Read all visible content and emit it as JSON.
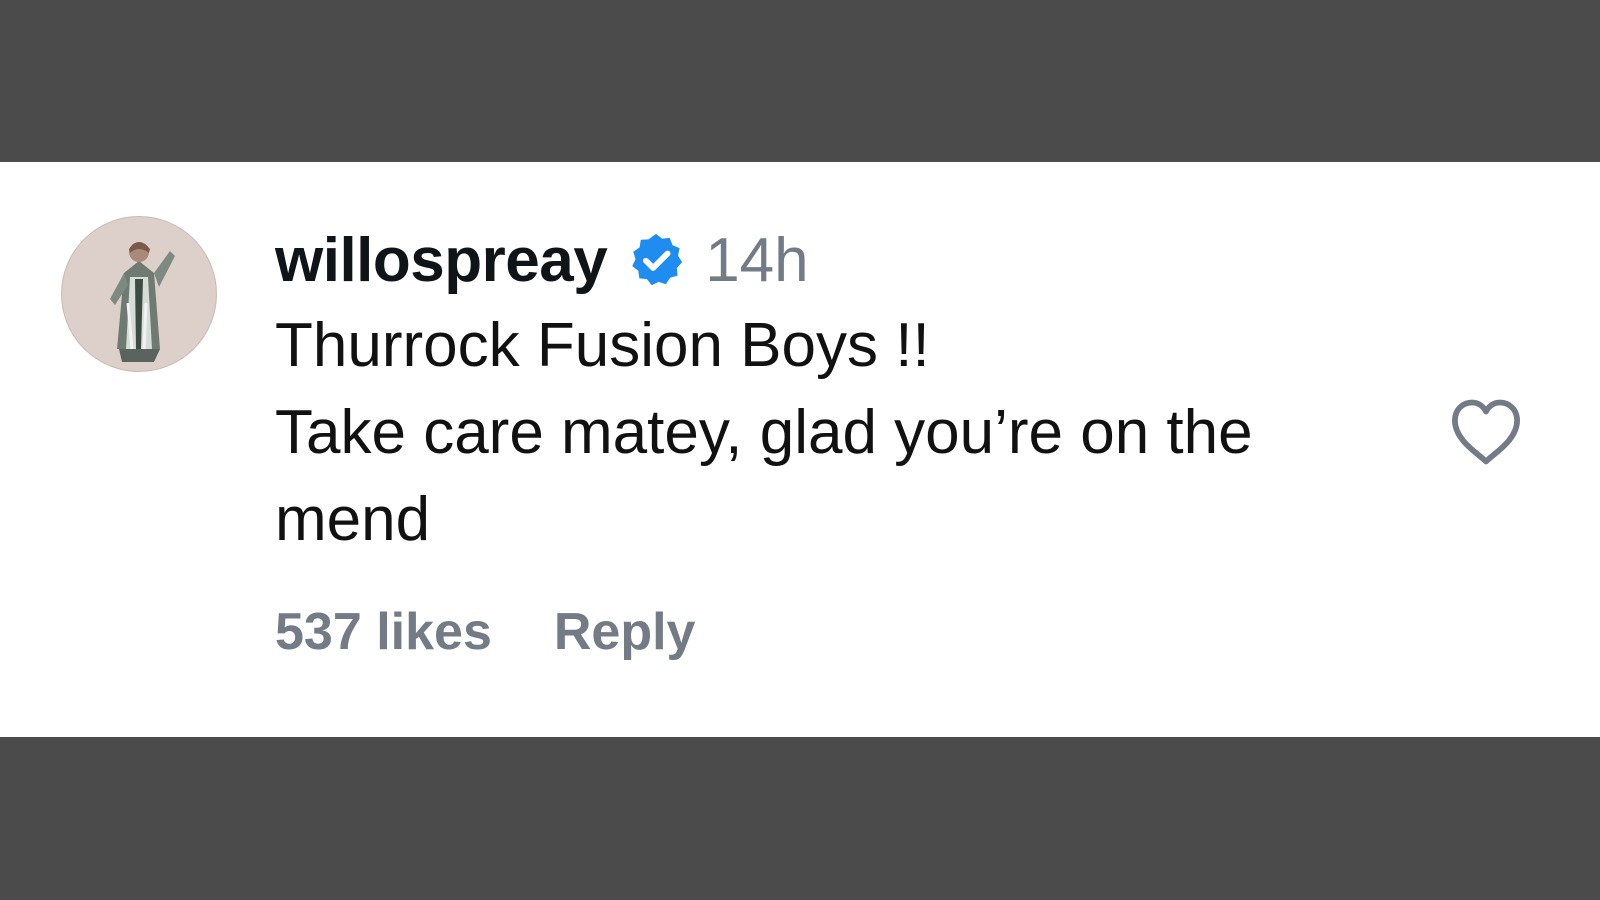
{
  "comment": {
    "username": "willospreay",
    "timestamp": "14h",
    "text_lines": [
      "Thurrock Fusion Boys !!",
      "Take care matey, glad you’re on the",
      "mend"
    ],
    "likes": "537 likes",
    "reply_label": "Reply"
  },
  "icons": {
    "avatar": "avatar-photo",
    "verified": "verified-badge-icon",
    "like": "heart-outline-icon"
  },
  "colors": {
    "background": "#4b4b4b",
    "card": "#ffffff",
    "text": "#111111",
    "muted": "#737b86",
    "verified": "#1f8cf0"
  }
}
